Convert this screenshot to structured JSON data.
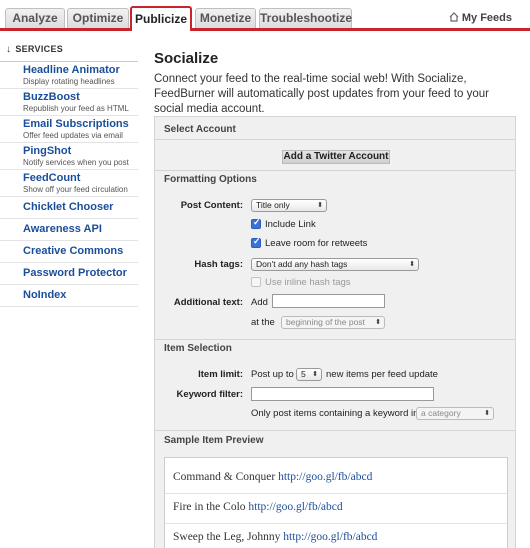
{
  "tabs": [
    "Analyze",
    "Optimize",
    "Publicize",
    "Monetize",
    "Troubleshootize"
  ],
  "my_feeds": "My Feeds",
  "sidebar": {
    "heading": "SERVICES",
    "items": [
      {
        "title": "Headline Animator",
        "desc": "Display rotating headlines"
      },
      {
        "title": "BuzzBoost",
        "desc": "Republish your feed as HTML"
      },
      {
        "title": "Email Subscriptions",
        "desc": "Offer feed updates via email"
      },
      {
        "title": "PingShot",
        "desc": "Notify services when you post"
      },
      {
        "title": "FeedCount",
        "desc": "Show off your feed circulation"
      },
      {
        "title": "Chicklet Chooser",
        "desc": ""
      },
      {
        "title": "Awareness API",
        "desc": ""
      },
      {
        "title": "Creative Commons",
        "desc": ""
      },
      {
        "title": "Password Protector",
        "desc": ""
      },
      {
        "title": "NoIndex",
        "desc": ""
      }
    ]
  },
  "main": {
    "title": "Socialize",
    "intro": "Connect your feed to the real-time social web! With Socialize, FeedBurner will automatically post updates from your feed to your social media account."
  },
  "select_account": {
    "title": "Select Account",
    "add_twitter": "Add a Twitter Account"
  },
  "formatting": {
    "title": "Formatting Options",
    "post_content_label": "Post Content:",
    "post_content_value": "Title only",
    "include_link": "Include Link",
    "include_link_checked": true,
    "leave_room": "Leave room for retweets",
    "leave_room_checked": true,
    "hash_tags_label": "Hash tags:",
    "hash_tags_value": "Don't add any hash tags",
    "use_inline": "Use inline hash tags",
    "use_inline_checked": false,
    "additional_text_label": "Additional text:",
    "add_word": "Add",
    "at_the": "at the",
    "position_value": "beginning of the post"
  },
  "item_selection": {
    "title": "Item Selection",
    "item_limit_label": "Item limit:",
    "post_up_to": "Post up to",
    "limit_value": "5",
    "new_items": "new items per feed update",
    "keyword_filter_label": "Keyword filter:",
    "only_post": "Only post items containing a keyword in",
    "category_value": "a category"
  },
  "preview": {
    "title": "Sample Item Preview",
    "items": [
      {
        "text": "Command & Conquer",
        "url": "http://goo.gl/fb/abcd"
      },
      {
        "text": "Fire in the Colo",
        "url": "http://goo.gl/fb/abcd"
      },
      {
        "text": "Sweep the Leg, Johnny",
        "url": "http://goo.gl/fb/abcd"
      }
    ]
  }
}
